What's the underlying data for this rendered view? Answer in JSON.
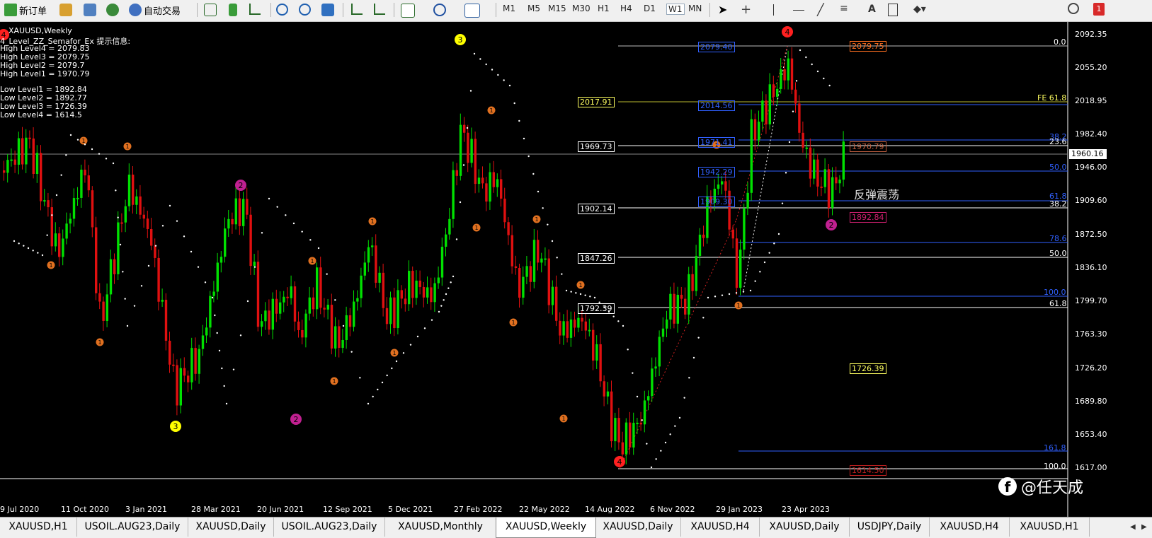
{
  "toolbar": {
    "new_order": "新订单",
    "auto_trade": "自动交易",
    "timeframes": [
      "M1",
      "M5",
      "M15",
      "M30",
      "H1",
      "H4",
      "D1",
      "W1",
      "MN"
    ],
    "notification_count": "1"
  },
  "chart": {
    "symbol_title": "XAUUSD,Weekly",
    "indicator_title": "4_Level_ZZ_Semafor_Ex 提示信息:",
    "high_levels": [
      "High Level4 = 2079.83",
      "High Level3 = 2079.75",
      "High Level2 = 2079.7",
      "High Level1 = 1970.79"
    ],
    "low_levels": [
      "Low Level1 = 1892.84",
      "Low Level2 = 1892.77",
      "Low Level3 = 1726.39",
      "Low Level4 = 1614.5"
    ],
    "price_axis": [
      "2092.35",
      "2055.20",
      "2018.95",
      "1982.40",
      "1946.00",
      "1909.60",
      "1872.50",
      "1836.10",
      "1799.70",
      "1763.30",
      "1726.20",
      "1689.80",
      "1653.40",
      "1617.00"
    ],
    "current_price": "1960.16",
    "date_axis": [
      "9 Jul 2020",
      "11 Oct 2020",
      "3 Jan 2021",
      "28 Mar 2021",
      "20 Jun 2021",
      "12 Sep 2021",
      "5 Dec 2021",
      "27 Feb 2022",
      "22 May 2022",
      "14 Aug 2022",
      "6 Nov 2022",
      "29 Jan 2023",
      "23 Apr 2023"
    ],
    "white_boxes": [
      "2017.91",
      "1969.73",
      "1902.14",
      "1847.26",
      "1792.39"
    ],
    "blue_boxes": [
      "2079.40",
      "2014.56",
      "1971.41",
      "1942.29",
      "1909.30"
    ],
    "orange_boxes": [
      "2079.75",
      "1970.79"
    ],
    "red_boxes": [
      "1892.84",
      "1614.50"
    ],
    "yellow_box": "1726.39",
    "fib_right": [
      "0.0",
      "FE 61.8",
      "38.2",
      "23.6",
      "50.0",
      "61.8",
      "38.2",
      "78.6",
      "50.0",
      "100.0",
      "61.8",
      "161.8",
      "100.0"
    ],
    "note": "反弹震荡",
    "watermark": "@任天成"
  },
  "tabs": [
    "XAUUSD,H1",
    "USOIL.AUG23,Daily",
    "XAUUSD,Daily",
    "USOIL.AUG23,Daily",
    "XAUUSD,Monthly",
    "XAUUSD,Weekly",
    "XAUUSD,Daily",
    "XAUUSD,H4",
    "XAUUSD,Daily",
    "USDJPY,Daily",
    "XAUUSD,H4",
    "XAUUSD,H1"
  ],
  "active_tab": "XAUUSD,Weekly",
  "colors": {
    "bull": "#00e000",
    "bear": "#e01010",
    "background": "#000000",
    "fib_blue": "#3060ff",
    "fib_white": "#ffffff"
  }
}
